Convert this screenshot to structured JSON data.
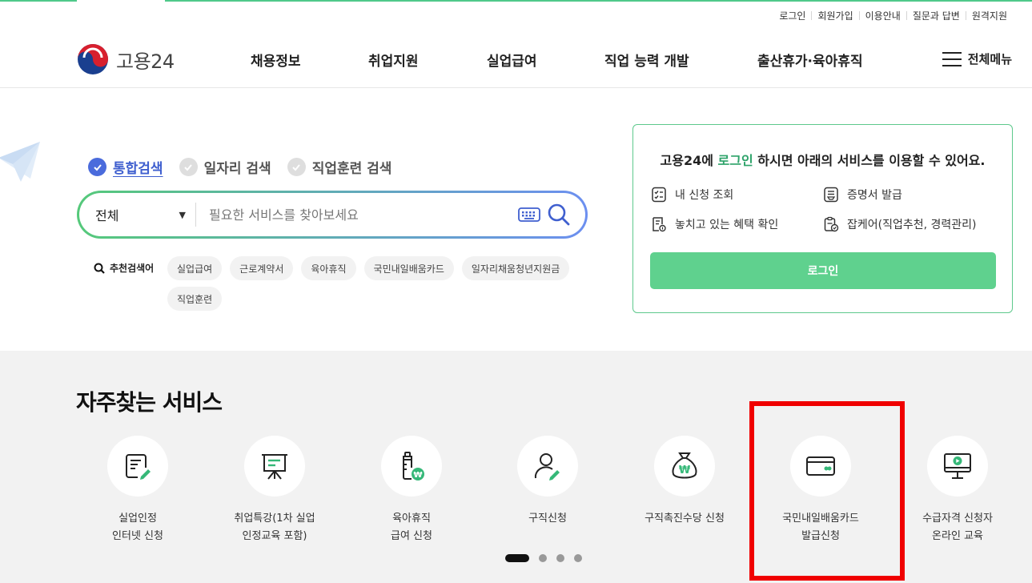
{
  "utility_nav": [
    "로그인",
    "회원가입",
    "이용안내",
    "질문과 답변",
    "원격지원"
  ],
  "logo": {
    "text": "고용24"
  },
  "gnb": [
    "채용정보",
    "취업지원",
    "실업급여",
    "직업 능력 개발",
    "출산휴가·육아휴직"
  ],
  "all_menu_label": "전체메뉴",
  "search": {
    "tabs": [
      {
        "label": "통합검색",
        "active": true
      },
      {
        "label": "일자리 검색",
        "active": false
      },
      {
        "label": "직업훈련 검색",
        "active": false
      }
    ],
    "scope_value": "전체",
    "placeholder": "필요한 서비스를 찾아보세요",
    "recommended_label": "추천검색어",
    "recommended": [
      "실업급여",
      "근로계약서",
      "육아휴직",
      "국민내일배움카드",
      "일자리채움청년지원금",
      "직업훈련"
    ]
  },
  "login_card": {
    "headline_pre": "고용24에",
    "headline_link": "로그인",
    "headline_post": "하시면 아래의 서비스를 이용할 수 있어요.",
    "services": [
      {
        "label": "내 신청 조회",
        "icon": "checklist-icon"
      },
      {
        "label": "증명서 발급",
        "icon": "certificate-icon"
      },
      {
        "label": "놓치고 있는 혜택 확인",
        "icon": "benefit-doc-icon"
      },
      {
        "label": "잡케어(직업추천, 경력관리)",
        "icon": "jobcare-icon"
      }
    ],
    "button": "로그인",
    "border_color": "#5ec98c",
    "button_color": "#5fd18e"
  },
  "favorites": {
    "title": "자주찾는 서비스",
    "items": [
      {
        "lines": [
          "실업인정",
          "인터넷 신청"
        ],
        "icon": "document-pen-icon"
      },
      {
        "lines": [
          "취업특강(1차 실업",
          "인정교육 포함)"
        ],
        "icon": "presentation-board-icon"
      },
      {
        "lines": [
          "육아휴직",
          "급여 신청"
        ],
        "icon": "baby-bottle-won-icon"
      },
      {
        "lines": [
          "구직신청"
        ],
        "icon": "person-pen-icon"
      },
      {
        "lines": [
          "구직촉진수당 신청"
        ],
        "icon": "money-bag-won-icon"
      },
      {
        "lines": [
          "국민내일배움카드",
          "발급신청"
        ],
        "icon": "card-icon"
      },
      {
        "lines": [
          "수급자격 신청자",
          "온라인 교육"
        ],
        "icon": "monitor-play-icon"
      }
    ],
    "carousel_pages": 4,
    "carousel_active": 1,
    "highlighted_item": "국민내일배움카드 발급신청",
    "highlight_color": "#f00000"
  }
}
